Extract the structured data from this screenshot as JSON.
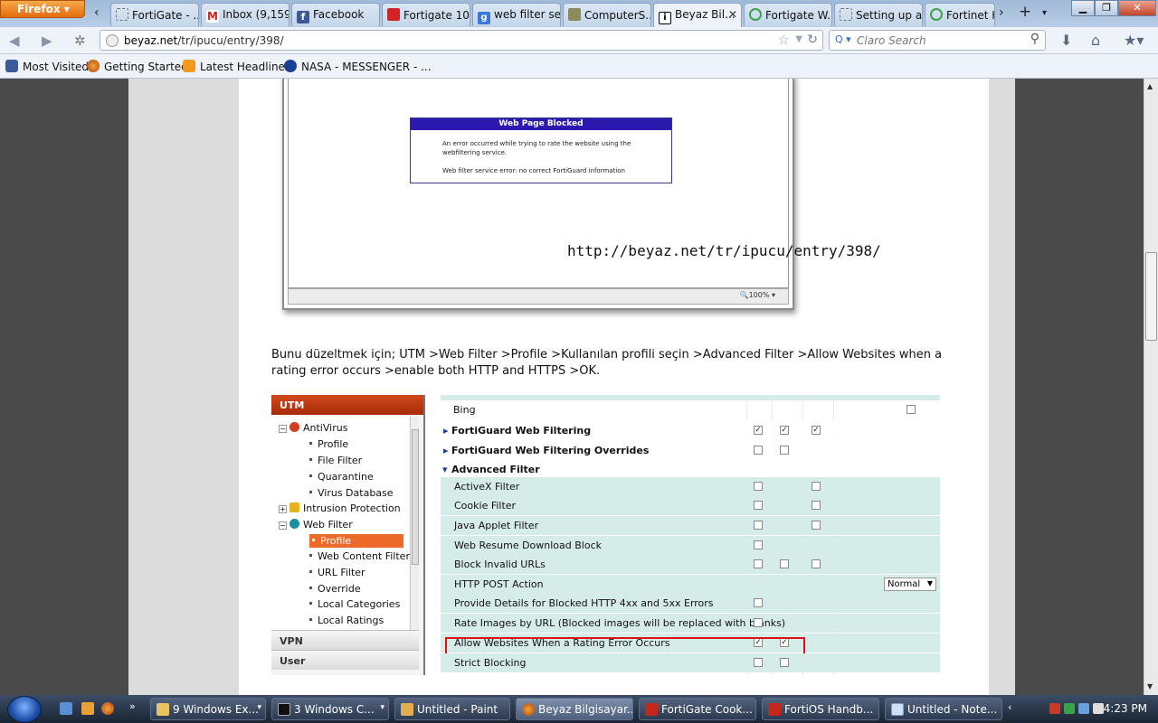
{
  "browser": {
    "menu_label": "Firefox",
    "tabs": [
      {
        "label": "FortiGate - ...",
        "icon": "blank-page-icon",
        "active": false
      },
      {
        "label": "Inbox (9,159...",
        "icon": "gmail-icon",
        "active": false
      },
      {
        "label": "Facebook",
        "icon": "facebook-icon",
        "active": false
      },
      {
        "label": "Fortigate 10...",
        "icon": "fortinet-icon",
        "active": false
      },
      {
        "label": "web filter se...",
        "icon": "google-icon",
        "active": false
      },
      {
        "label": "ComputerS...",
        "icon": "computers-icon",
        "active": false
      },
      {
        "label": "Beyaz Bil...",
        "icon": "beyaz-icon",
        "active": true
      },
      {
        "label": "Fortigate W...",
        "icon": "loading-icon",
        "active": false
      },
      {
        "label": "Setting up a...",
        "icon": "blank-page-icon",
        "active": false
      },
      {
        "label": "Fortinet K...",
        "icon": "loading-icon",
        "active": false
      }
    ],
    "url_domain": "beyaz.net",
    "url_path": "/tr/ipucu/entry/398/",
    "search_placeholder": "Claro Search",
    "bookmarks": [
      {
        "label": "Most Visited",
        "icon": "gear-icon"
      },
      {
        "label": "Getting Started",
        "icon": "firefox-icon"
      },
      {
        "label": "Latest Headlines",
        "icon": "rss-icon"
      },
      {
        "label": "NASA - MESSENGER - ...",
        "icon": "nasa-icon"
      }
    ]
  },
  "article": {
    "blocked_title": "Web Page Blocked",
    "blocked_line1": "An error occurred while trying to rate the website using the",
    "blocked_line2": "webfiltering service.",
    "blocked_line3": "Web filter service error: no correct FortiGuard information",
    "zoom": "100%",
    "watermark": "http://beyaz.net/tr/ipucu/entry/398/",
    "paragraph": "Bunu düzeltmek için; UTM >Web Filter >Profile >Kullanılan profili seçin >Advanced Filter >Allow Websites when a rating error occurs >enable both HTTP and HTTPS >OK."
  },
  "utm": {
    "title": "UTM",
    "tree": {
      "antivirus": "AntiVirus",
      "av_profile": "Profile",
      "file_filter": "File Filter",
      "quarantine": "Quarantine",
      "virus_database": "Virus Database",
      "intrusion": "Intrusion Protection",
      "web_filter": "Web Filter",
      "wf_profile": "Profile",
      "web_content_filter": "Web Content Filter",
      "url_filter": "URL Filter",
      "override": "Override",
      "local_categories": "Local Categories",
      "local_ratings": "Local Ratings"
    },
    "vpn": "VPN",
    "user": "User"
  },
  "options": {
    "bing": "Bing",
    "fortiguard": "FortiGuard Web Filtering",
    "fortiguard_overrides": "FortiGuard Web Filtering Overrides",
    "advanced_filter": "Advanced Filter",
    "activex": "ActiveX Filter",
    "cookie": "Cookie Filter",
    "java": "Java Applet Filter",
    "resume": "Web Resume Download Block",
    "invalid_urls": "Block Invalid URLs",
    "http_post": "HTTP POST Action",
    "http_post_value": "Normal",
    "provide_details": "Provide Details for Blocked HTTP 4xx and 5xx Errors",
    "rate_images": "Rate Images by URL (Blocked images will be replaced with blanks)",
    "allow_websites": "Allow Websites When a Rating Error Occurs",
    "strict": "Strict Blocking"
  },
  "taskbar": {
    "items": [
      {
        "label": "9 Windows Ex...",
        "icon": "folder-icon"
      },
      {
        "label": "3 Windows C...",
        "icon": "cmd-icon"
      },
      {
        "label": "Untitled - Paint",
        "icon": "paint-icon"
      },
      {
        "label": "Beyaz Bilgisayar...",
        "icon": "firefox-icon"
      },
      {
        "label": "FortiGate Cook...",
        "icon": "pdf-icon"
      },
      {
        "label": "FortiOS Handb...",
        "icon": "pdf-icon"
      },
      {
        "label": "Untitled - Note...",
        "icon": "notepad-icon"
      }
    ],
    "clock": "4:23 PM"
  }
}
